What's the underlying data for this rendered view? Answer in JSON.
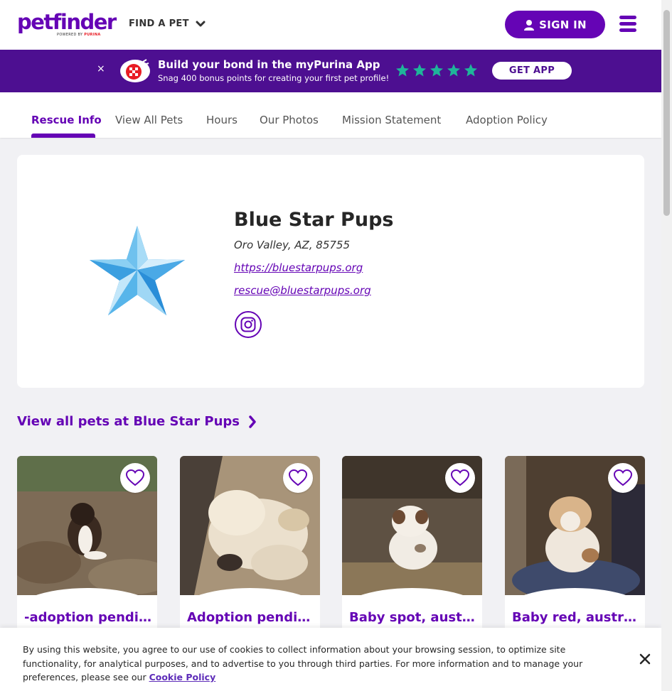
{
  "header": {
    "logo_text": "petfinder",
    "logo_sub_prefix": "POWERED BY",
    "logo_sub_brand": "PURINA",
    "find_pet": "FIND A PET",
    "sign_in": "SIGN IN",
    "menu_icon": "hamburger-icon"
  },
  "promo": {
    "close": "×",
    "title": "Build your bond in the myPurina App",
    "subtitle": "Snag 400 bonus points for creating your first pet profile!",
    "rating_stars": 5,
    "cta": "GET APP",
    "bg_color": "#4d0f91",
    "star_color": "#1fb49a"
  },
  "tabs": [
    {
      "label": "Rescue Info",
      "active": true
    },
    {
      "label": "View All Pets",
      "active": false
    },
    {
      "label": "Hours",
      "active": false
    },
    {
      "label": "Our Photos",
      "active": false
    },
    {
      "label": "Mission Statement",
      "active": false
    },
    {
      "label": "Adoption Policy",
      "active": false
    }
  ],
  "rescue": {
    "name": "Blue Star Pups",
    "location": "Oro Valley, AZ, 85755",
    "website": "https://bluestarpups.org",
    "email": "rescue@bluestarpups.org",
    "social_icon": "instagram-icon"
  },
  "view_all": "View all pets at Blue Star Pups",
  "pets": [
    {
      "name": "-adoption pending-, australian shepherd",
      "photo_bg": "#8a7a66"
    },
    {
      "name": "Adoption pending, australian shepherd",
      "photo_bg": "#b9a990"
    },
    {
      "name": "Baby spot, australian cattle dog",
      "photo_bg": "#6d5d4a"
    },
    {
      "name": "Baby red, australian cattle dog",
      "photo_bg": "#5a4a3a"
    }
  ],
  "cookie": {
    "text": "By using this website, you agree to our use of cookies to collect information about your browsing session, to optimize site functionality, for analytical purposes, and to advertise to you through third parties. For more information and to manage your preferences, please see our",
    "link": "Cookie Policy",
    "close": "×"
  },
  "colors": {
    "brand": "#6504b5",
    "page_bg": "#f1f1f4"
  }
}
